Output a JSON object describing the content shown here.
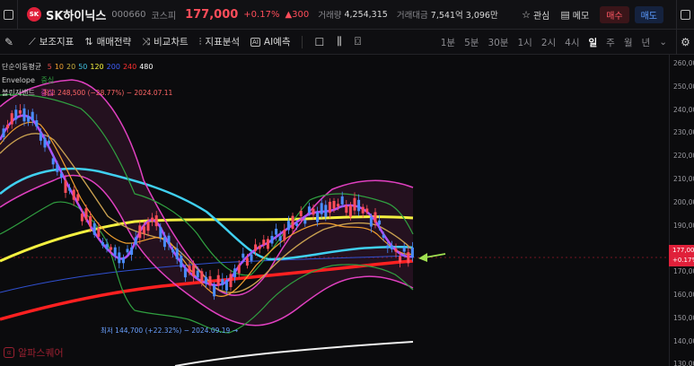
{
  "header": {
    "logo_text": "SK",
    "name": "SK하이닉스",
    "code": "000660",
    "market": "코스피",
    "price": "177,000",
    "change_pct": "+0.17%",
    "change_abs": "▲300",
    "volume_label": "거래량",
    "volume": "4,254,315",
    "amount_label": "거래대금",
    "amount": "7,541억 3,096만",
    "watch_label": "관심",
    "memo_label": "메모",
    "buy_label": "매수",
    "sell_label": "매도"
  },
  "toolbar": {
    "indicator": "보조지표",
    "strategy": "매매전략",
    "compare": "비교차트",
    "analysis": "지표분석",
    "ai_badge": "AI",
    "ai": "AI예측",
    "periods": [
      "1분",
      "5분",
      "30분",
      "1시",
      "2시",
      "4시",
      "일",
      "주",
      "월",
      "년"
    ],
    "active_period": "일",
    "more_icon": "chevron-down-icon"
  },
  "legend": {
    "ma_name": "단순이동평균",
    "ma_periods": [
      {
        "label": "5",
        "color": "#e34b4b"
      },
      {
        "label": "10",
        "color": "#f0a030"
      },
      {
        "label": "20",
        "color": "#c8b040"
      },
      {
        "label": "50",
        "color": "#40c0e0"
      },
      {
        "label": "120",
        "color": "#f4f040"
      },
      {
        "label": "200",
        "color": "#4060ff"
      },
      {
        "label": "240",
        "color": "#ff3030"
      },
      {
        "label": "480",
        "color": "#ffffff"
      }
    ],
    "envelope_name": "Envelope",
    "envelope_value": "중심",
    "bollinger_name": "볼린저밴드",
    "bollinger_value": "중심"
  },
  "annotations": {
    "high": "최고 248,500 (−28.77%) − 2024.07.11",
    "low": "최저 144,700 (+22.32%) − 2024.09.19 →"
  },
  "axis": {
    "ticks": [
      "260,000",
      "250,000",
      "240,000",
      "230,000",
      "220,000",
      "210,000",
      "200,000",
      "190,000",
      "180,000",
      "170,000",
      "160,000",
      "150,000",
      "140,000",
      "130,000"
    ],
    "current_price": "177,000",
    "current_change": "+0.17%",
    "current_extra": "01"
  },
  "watermark": "알파스퀘어",
  "colors": {
    "up": "#ff4d5a",
    "down": "#4a8dff",
    "accent": "#e0203a"
  }
}
